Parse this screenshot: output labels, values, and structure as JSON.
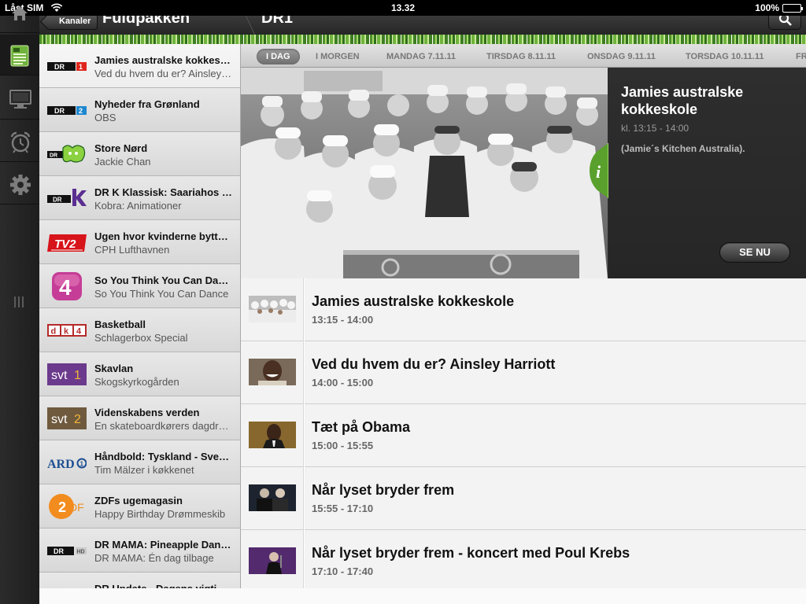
{
  "status_bar": {
    "carrier": "Låst SIM",
    "time": "13.32",
    "battery": "100%"
  },
  "header": {
    "back_label": "Kanaler",
    "package_title": "Fuldpakken",
    "channel_title": "DR1"
  },
  "colors": {
    "accent_green": "#5aa02c",
    "panel_dark": "#2b2b2b",
    "list_bg": "#f3f3f3"
  },
  "nav_icons": [
    "home-icon",
    "tv-guide-icon",
    "tv-icon",
    "alarm-clock-icon",
    "gear-icon"
  ],
  "channels": [
    {
      "logo": "DR 1",
      "title": "Jamies australske kokkeskole",
      "subtitle": "Ved du hvem du er? Ainsley Harriott",
      "active": true
    },
    {
      "logo": "DR 2",
      "title": "Nyheder fra Grønland",
      "subtitle": "OBS"
    },
    {
      "logo": "DR Ramasjang",
      "title": "Store Nørd",
      "subtitle": "Jackie Chan"
    },
    {
      "logo": "DR K",
      "title": "DR K Klassisk: Saariahos verden",
      "subtitle": "Kobra: Animationer"
    },
    {
      "logo": "TV2",
      "title": "Ugen hvor kvinderne byttede",
      "subtitle": "CPH Lufthavnen"
    },
    {
      "logo": "4",
      "title": "So You Think You Can Dance",
      "subtitle": "So You Think You Can Dance"
    },
    {
      "logo": "dk4",
      "title": "Basketball",
      "subtitle": "Schlagerbox Special"
    },
    {
      "logo": "svt1",
      "title": "Skavlan",
      "subtitle": "Skogskyrkogården"
    },
    {
      "logo": "svt2",
      "title": "Videnskabens verden",
      "subtitle": "En skateboardkørers dagdrøm"
    },
    {
      "logo": "ARD",
      "title": "Håndbold: Tyskland - Sverige",
      "subtitle": "Tim Mälzer i køkkenet"
    },
    {
      "logo": "ZDF",
      "title": "ZDFs ugemagasin",
      "subtitle": "Happy Birthday Drømmeskib"
    },
    {
      "logo": "DR HD",
      "title": "DR MAMA: Pineapple Dance Studios",
      "subtitle": "DR MAMA: Én dag tilbage"
    },
    {
      "logo": "DR Update",
      "title": "DR Update - Dagens vigtigste",
      "subtitle": ""
    }
  ],
  "days": [
    {
      "label": "I DAG",
      "active": true
    },
    {
      "label": "I MORGEN"
    },
    {
      "label": "MANDAG 7.11.11"
    },
    {
      "label": "TIRSDAG 8.11.11"
    },
    {
      "label": "ONSDAG 9.11.11"
    },
    {
      "label": "TORSDAG 10.11.11"
    },
    {
      "label": "FR"
    }
  ],
  "featured": {
    "title": "Jamies australske kokkeskole",
    "time": "kl. 13:15 - 14:00",
    "description": "(Jamie´s Kitchen Australia).",
    "watch_label": "SE NU"
  },
  "programs": [
    {
      "title": "Jamies australske kokkeskole",
      "time": "13:15 - 14:00",
      "thumb": "chefs-group"
    },
    {
      "title": "Ved du hvem du er? Ainsley Harriott",
      "time": "14:00 - 15:00",
      "thumb": "smiling-man"
    },
    {
      "title": "Tæt på Obama",
      "time": "15:00 - 15:55",
      "thumb": "portrait-dark"
    },
    {
      "title": "Når lyset bryder frem",
      "time": "15:55 - 17:10",
      "thumb": "two-men"
    },
    {
      "title": "Når lyset bryder frem - koncert med Poul Krebs",
      "time": "17:10 - 17:40",
      "thumb": "concert-stage"
    }
  ]
}
